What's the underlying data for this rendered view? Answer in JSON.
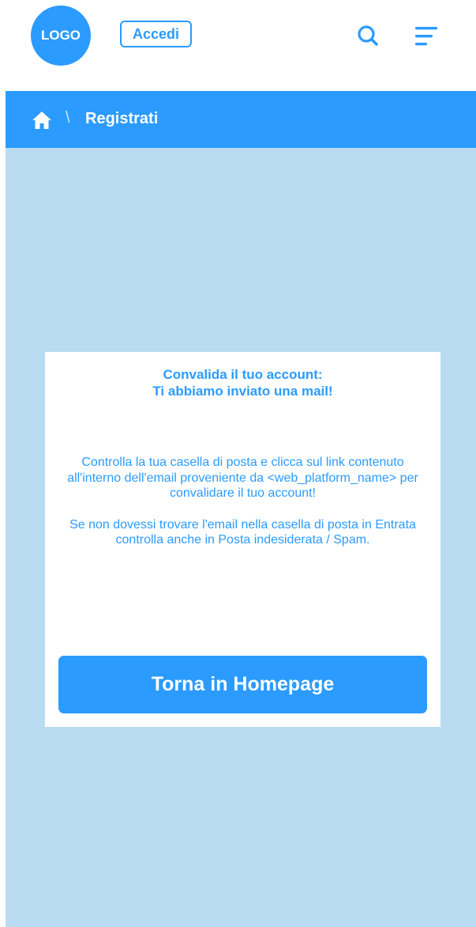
{
  "header": {
    "logo_text": "LOGO",
    "login_label": "Accedi",
    "search_icon": "search-icon",
    "menu_icon": "hamburger-menu-icon"
  },
  "breadcrumb": {
    "home_icon": "home-icon",
    "separator": "\\",
    "current": "Registrati"
  },
  "card": {
    "title_line1": "Convalida il tuo account:",
    "title_line2": "Ti abbiamo inviato una mail!",
    "paragraph1": "Controlla la tua casella di posta e clicca sul link contenuto all'interno dell'email proveniente da <web_platform_name> per convalidare il tuo account!",
    "paragraph2": "Se non dovessi trovare l'email nella casella di posta in Entrata controlla anche in Posta indesiderata / Spam.",
    "cta_label": "Torna in Homepage"
  },
  "colors": {
    "primary": "#2b9bff",
    "background": "#badcf2",
    "card": "#ffffff"
  }
}
